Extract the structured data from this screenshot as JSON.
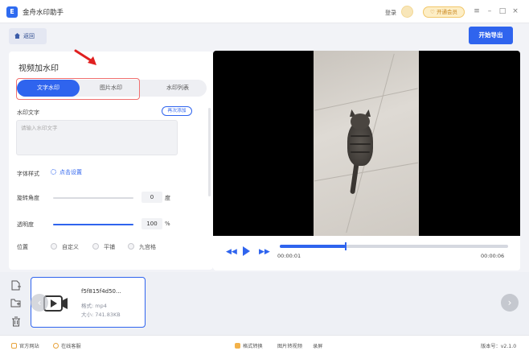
{
  "app": {
    "title": "金舟水印助手",
    "logo_letter": "E"
  },
  "titlebar": {
    "login": "登录",
    "vip": "开通会员"
  },
  "toolbar": {
    "back": "返回",
    "export": "开始导出"
  },
  "panel": {
    "title": "视频加水印",
    "tabs": [
      {
        "label": "文字水印",
        "active": true
      },
      {
        "label": "图片水印",
        "active": false
      },
      {
        "label": "水印列表",
        "active": false
      }
    ],
    "watermark_text_label": "水印文字",
    "readd": "再次添加",
    "textarea_placeholder": "请输入水印文字",
    "font_style_label": "字体样式",
    "font_style_link": "点击设置",
    "rotation": {
      "label": "旋转角度",
      "value": "0",
      "unit": "度",
      "fraction": 0.0
    },
    "opacity": {
      "label": "透明度",
      "value": "100",
      "unit": "%",
      "fraction": 1.0
    },
    "position": {
      "label": "位置",
      "options": [
        "自定义",
        "平铺",
        "九宫格"
      ]
    }
  },
  "player": {
    "current_time": "00:00:01",
    "total_time": "00:00:06",
    "progress": 0.29
  },
  "file": {
    "name": "f5f815f4d50...",
    "format": "格式: mp4",
    "size": "大小: 741.83KB"
  },
  "status": {
    "website": "官方网站",
    "service": "在线客服",
    "tools": [
      "格式转换",
      "图片转视频",
      "录屏"
    ],
    "version": "版本号：v2.1.0"
  },
  "colors": {
    "accent": "#2f64ee",
    "highlight_box": "#f07070",
    "arrow": "#e02020"
  }
}
